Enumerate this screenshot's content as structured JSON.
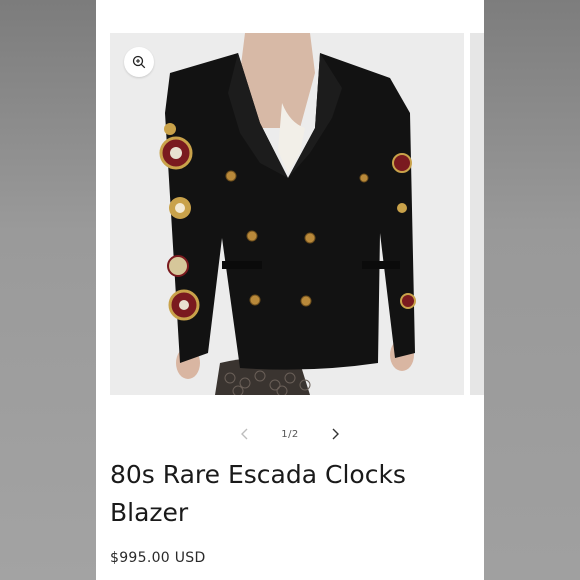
{
  "product": {
    "title_line1": "80s Rare Escada Clocks",
    "title_line2": "Blazer",
    "price": "$995.00 USD"
  },
  "gallery": {
    "counter": "1/2",
    "icons": {
      "zoom": "zoom-in-icon",
      "prev": "chevron-left-icon",
      "next": "chevron-right-icon"
    }
  },
  "colors": {
    "blazer": "#121212",
    "patch_red": "#7a1a1f",
    "patch_gold": "#c9a24a",
    "background": "#ffffff"
  }
}
